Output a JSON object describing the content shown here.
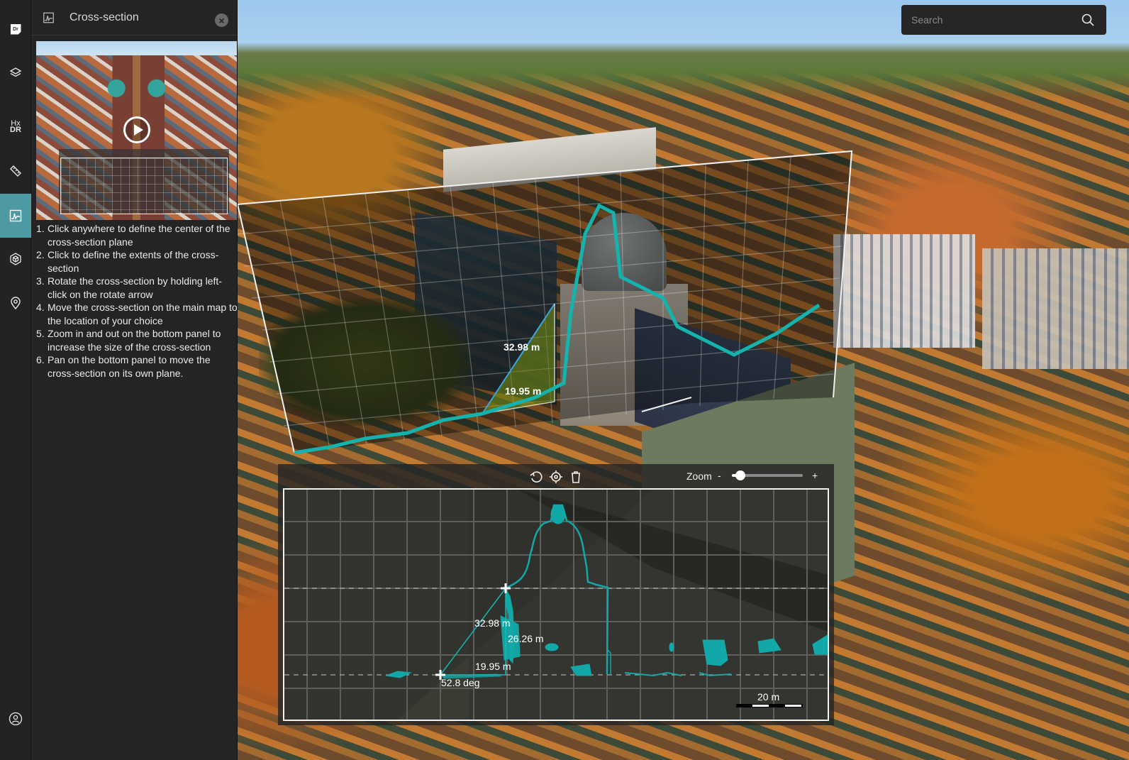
{
  "rail": {
    "items": [
      {
        "id": "logo",
        "label": "Dr",
        "icon": "app-logo-icon",
        "active": false
      },
      {
        "id": "layers",
        "icon": "layers-icon",
        "active": false
      },
      {
        "id": "hxdr",
        "label_top": "Hx",
        "label_bottom": "DR",
        "icon": "hxdr-icon",
        "active": false
      },
      {
        "id": "measure",
        "icon": "ruler-icon",
        "active": false
      },
      {
        "id": "cross-section",
        "icon": "cross-section-icon",
        "active": true
      },
      {
        "id": "3d-model",
        "icon": "cube-icon",
        "active": false
      },
      {
        "id": "location",
        "icon": "map-pin-icon",
        "active": false
      },
      {
        "id": "account",
        "icon": "user-icon",
        "active": false
      }
    ]
  },
  "panel": {
    "title": "Cross-section",
    "close_icon": "close-icon",
    "video": {
      "play_icon": "play-icon"
    },
    "instructions": [
      {
        "num": "1.",
        "text": "Click anywhere to define the center of the cross-section plane"
      },
      {
        "num": "2.",
        "text": " Click to define the extents of the cross-section"
      },
      {
        "num": "3.",
        "text": "Rotate the cross-section by holding left-click on the rotate arrow"
      },
      {
        "num": "4.",
        "text": "Move the cross-section on the main map to the location of your choice"
      },
      {
        "num": "5.",
        "text": "Zoom in and out on the bottom panel to increase the size of the cross-section"
      },
      {
        "num": "6.",
        "text": "Pan on the bottom panel to move the cross-section on its own plane."
      }
    ]
  },
  "search": {
    "placeholder": "Search",
    "value": "",
    "icon": "search-icon"
  },
  "map_labels": {
    "hypotenuse": "32.98 m",
    "base": "19.95 m"
  },
  "cross_section": {
    "toolbar": {
      "rotate_icon": "rotate-icon",
      "locate_icon": "locate-icon",
      "delete_icon": "trash-icon",
      "zoom_label": "Zoom",
      "zoom_minus": "-",
      "zoom_plus": "+",
      "zoom_level": 0.12
    },
    "measurements": {
      "hypotenuse": "32.98 m",
      "height": "26.26 m",
      "base": "19.95 m",
      "angle": "52.8 deg"
    },
    "scale_label": "20 m",
    "colors": {
      "profile": "#12a8a8",
      "accent": "#4e9aa4"
    }
  }
}
